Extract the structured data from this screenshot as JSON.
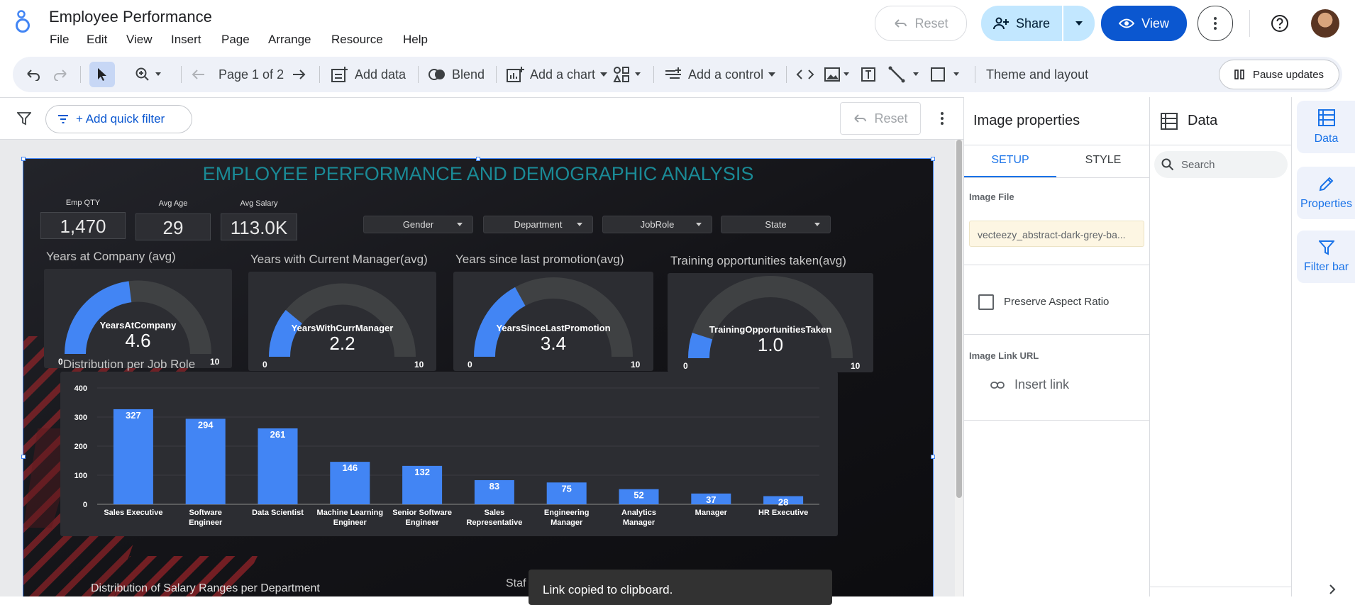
{
  "app": {
    "title": "Employee Performance",
    "menu": [
      "File",
      "Edit",
      "View",
      "Insert",
      "Page",
      "Arrange",
      "Resource",
      "Help"
    ],
    "reset_label": "Reset",
    "share_label": "Share",
    "view_label": "View"
  },
  "toolbar": {
    "page_label": "Page 1 of 2",
    "add_data": "Add data",
    "blend": "Blend",
    "add_chart": "Add a chart",
    "add_control": "Add a control",
    "theme_layout": "Theme and layout",
    "pause_updates": "Pause updates"
  },
  "filterbar": {
    "add_quick_filter": "+ Add quick filter",
    "reset_label": "Reset"
  },
  "report": {
    "title": "EMPLOYEE PERFORMANCE AND DEMOGRAPHIC ANALYSIS",
    "kpis": [
      {
        "label": "Emp QTY",
        "value": "1,470"
      },
      {
        "label": "Avg Age",
        "value": "29"
      },
      {
        "label": "Avg Salary",
        "value": "113.0K"
      }
    ],
    "filters": [
      "Gender",
      "Department",
      "JobRole",
      "State"
    ],
    "gauges": [
      {
        "title": "Years at Company (avg)",
        "metric": "YearsAtCompany",
        "value": "4.6",
        "fraction": 0.46,
        "min": "0",
        "max": "10"
      },
      {
        "title": "Years with Current Manager(avg)",
        "metric": "YearsWithCurrManager",
        "value": "2.2",
        "fraction": 0.22,
        "min": "0",
        "max": "10"
      },
      {
        "title": "Years since last promotion(avg)",
        "metric": "YearsSinceLastPromotion",
        "value": "3.4",
        "fraction": 0.34,
        "min": "0",
        "max": "10"
      },
      {
        "title": "Training opportunities taken(avg)",
        "metric": "TrainingOpportunitiesTaken",
        "value": "1.0",
        "fraction": 0.1,
        "min": "0",
        "max": "10"
      }
    ],
    "bar_title": "Distribution per Job Role",
    "bottom_title_left": "Distribution of Salary Ranges per Department",
    "bottom_title_right": "Staf"
  },
  "chart_data": {
    "type": "bar",
    "title": "Distribution per Job Role",
    "categories": [
      "Sales Executive",
      "Software Engineer",
      "Data Scientist",
      "Machine Learning Engineer",
      "Senior Software Engineer",
      "Sales Representative",
      "Engineering Manager",
      "Analytics Manager",
      "Manager",
      "HR Executive"
    ],
    "category_lines": [
      [
        "Sales Executive"
      ],
      [
        "Software",
        "Engineer"
      ],
      [
        "Data Scientist"
      ],
      [
        "Machine Learning",
        "Engineer"
      ],
      [
        "Senior Software",
        "Engineer"
      ],
      [
        "Sales",
        "Representative"
      ],
      [
        "Engineering",
        "Manager"
      ],
      [
        "Analytics",
        "Manager"
      ],
      [
        "Manager"
      ],
      [
        "HR Executive"
      ]
    ],
    "values": [
      327,
      294,
      261,
      146,
      132,
      83,
      75,
      52,
      37,
      28
    ],
    "ylim": [
      0,
      400
    ],
    "yticks": [
      0,
      100,
      200,
      300,
      400
    ],
    "color": "#4285f4",
    "grid": true
  },
  "props": {
    "title": "Image properties",
    "tab_setup": "SETUP",
    "tab_style": "STYLE",
    "image_file_label": "Image File",
    "image_file_value": "vecteezy_abstract-dark-grey-ba...",
    "preserve_aspect": "Preserve Aspect Ratio",
    "link_label": "Image Link URL",
    "insert_link": "Insert link"
  },
  "datapanel": {
    "title": "Data",
    "search_placeholder": "Search"
  },
  "sidetabs": [
    "Data",
    "Properties",
    "Filter bar"
  ],
  "toast": "Link copied to clipboard.",
  "colors": {
    "accent": "#1a73e8",
    "title_teal": "#1a8a96",
    "gauge_fill": "#4285f4",
    "gauge_track": "#3f4143"
  }
}
